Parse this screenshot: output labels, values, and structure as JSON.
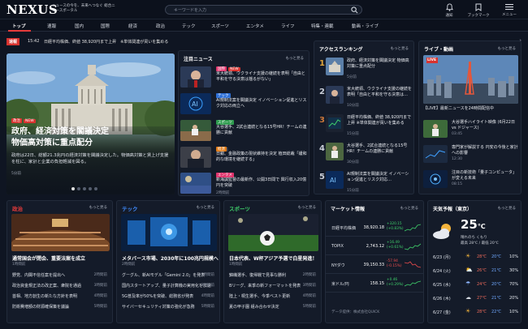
{
  "header": {
    "logo": "NEXUS",
    "tagline": "ニュースの今を、未来へつなぐ 総合ニュースポータル",
    "search_placeholder": "キーワードを入力",
    "icons": [
      {
        "name": "bell-icon",
        "label": "通知"
      },
      {
        "name": "bookmark-icon",
        "label": "ブックマーク"
      },
      {
        "name": "menu-icon",
        "label": "メニュー"
      }
    ]
  },
  "nav": [
    "トップ",
    "速報",
    "国内",
    "国際",
    "経済",
    "政治",
    "テック",
    "スポーツ",
    "エンタメ",
    "ライフ",
    "特集・連載",
    "動画・ライブ"
  ],
  "ticker": {
    "label": "速報",
    "time": "15:42",
    "text": "日経平均株価、終値 38,920円まで上昇　※単体関連が買いを集める"
  },
  "hero": {
    "badges": [
      "政治",
      "NEW"
    ],
    "title_line1": "政府、経済対策を閣議決定",
    "title_line2": "物価高対策に重点配分",
    "summary": "政府は22日、総額21.3兆円の経済対策を閣議決定した。物価高対策と賃上げ支援を柱に、家計と企業の負担軽減を図る。",
    "time": "5分前"
  },
  "attention": {
    "title": "注目ニュース",
    "more": "もっと見る",
    "items": [
      {
        "badges": [
          "国際",
          "NEW"
        ],
        "title": "米大統領、ウクライナ支援の継続を表明「自由と平和を守る決意は揺るがない」",
        "time": "10分前"
      },
      {
        "badges": [
          "テック"
        ],
        "title": "AI規制法案を閣議決定 イノベーション促進とリスク対応の両立へ",
        "time": "15分前"
      },
      {
        "badges": [
          "スポーツ"
        ],
        "title": "大谷選手、2試合連続となる15号HR！チームの連勝に貢献",
        "time": "30分前"
      },
      {
        "badges": [
          "経済"
        ],
        "title": "日銀、金融政策の現状維持を決定 植田総裁「緩和的な環境を継続する」",
        "time": "1時間前"
      },
      {
        "badges": [
          "エンタメ"
        ],
        "title": "新海誠監督の最新作、公開3日間で 興行収入20億円を突破",
        "time": "2時間前"
      }
    ]
  },
  "ranking": {
    "title": "アクセスランキング",
    "more": "もっと見る",
    "items": [
      {
        "rank": "1",
        "title": "政府、経済対策を閣議決定 物価高対策に重点配分",
        "time": "5分前"
      },
      {
        "rank": "2",
        "title": "米大統領、ウクライナ支援の継続を表明「自由と平和を守る決意は…",
        "time": "10分前"
      },
      {
        "rank": "3",
        "title": "日経平均株価、終値 38,920円まで上昇 ※単体関連が買いを集める",
        "time": "15分前"
      },
      {
        "rank": "4",
        "title": "大谷選手、2試合連続となる15号HR！チームの連勝に貢献",
        "time": "30分前"
      },
      {
        "rank": "5",
        "title": "AI規制法案を閣議決定 イノベーション促進とリスク対応…",
        "time": "15分前"
      }
    ]
  },
  "live": {
    "title": "ライブ・動画",
    "more": "もっと見る",
    "badge": "LIVE",
    "main_title": "【LIVE】最新ニュースを24時間配信中",
    "items": [
      {
        "title": "大谷選手ハイライト映像 (6月22日 vs ドジャース)",
        "duration": "03:45"
      },
      {
        "title": "専門家が解説する 円安の今後と家計への影響",
        "duration": "12:30"
      },
      {
        "title": "注目の新技術「量子コンピュータ」が変える未来",
        "duration": "08:15"
      }
    ]
  },
  "politics": {
    "title": "政治",
    "more": "もっと見る",
    "lead": "通常国会が閉会、重要法案を成立",
    "lead_time": "1時間前",
    "items": [
      {
        "title": "野党、内閣不信任案を提出へ",
        "time": "2時間前"
      },
      {
        "title": "政治資金規正法の改正案、衆院を通過",
        "time": "3時間前"
      },
      {
        "title": "首相、地方創生の新たな方針を表明",
        "time": "4時間前"
      },
      {
        "title": "防衛費増額の財源確保策を議論",
        "time": "5時間前"
      }
    ]
  },
  "tech": {
    "title": "テック",
    "more": "もっと見る",
    "lead": "メタバース市場、2030年に100兆円規模へ",
    "lead_time": "2時間前",
    "items": [
      {
        "title": "グーグル、新AIモデル「Gemini 2.0」を発表",
        "time": "1時間前"
      },
      {
        "title": "国内スタートアップ、量子計算機の実用化を加速",
        "time": "3時間前"
      },
      {
        "title": "5G普及率が50%を突破、総務省が発表",
        "time": "4時間前"
      },
      {
        "title": "サイバーセキュリティ対策の強化が急務",
        "time": "5時間前"
      }
    ]
  },
  "sports": {
    "title": "スポーツ",
    "more": "もっと見る",
    "lead": "日本代表、W杯アジア予選で白星発進！",
    "lead_time": "1時間前",
    "items": [
      {
        "title": "錦織選手、復帰戦で見事な勝利",
        "time": "2時間前"
      },
      {
        "title": "Bリーグ、来季の新フォーマットを発表",
        "time": "3時間前"
      },
      {
        "title": "陸上・桐生選手、今季ベスト更新",
        "time": "4時間前"
      },
      {
        "title": "夏の甲子園 組み合わせ決定",
        "time": "5時間前"
      }
    ]
  },
  "market": {
    "title": "マーケット情報",
    "more": "もっと見る",
    "rows": [
      {
        "name": "日経平均株価",
        "value": "38,920.18",
        "change": "+320.15",
        "pct": "(+0.83%)",
        "dir": "up"
      },
      {
        "name": "TOPIX",
        "value": "2,743.12",
        "change": "+16.49",
        "pct": "(+0.61%)",
        "dir": "up"
      },
      {
        "name": "NYダウ",
        "value": "39,150.33",
        "change": "-57.94",
        "pct": "(-0.15%)",
        "dir": "down"
      },
      {
        "name": "米ドル/円",
        "value": "158.15",
        "change": "+0.46",
        "pct": "(+0.29%)",
        "dir": "up"
      }
    ],
    "source": "データ提供：株式会社QUICK"
  },
  "weather": {
    "title": "天気予報（東京）",
    "more": "もっと見る",
    "temp": "25",
    "unit": "℃",
    "desc": "晴れのち くもり",
    "range": "最高 28℃ / 最低 20℃",
    "days": [
      {
        "day": "6/23 (月)",
        "hi": "28℃",
        "lo": "20℃",
        "pct": "10%"
      },
      {
        "day": "6/24 (火)",
        "hi": "26℃",
        "lo": "21℃",
        "pct": "30%"
      },
      {
        "day": "6/25 (水)",
        "hi": "24℃",
        "lo": "20℃",
        "pct": "70%"
      },
      {
        "day": "6/26 (木)",
        "hi": "27℃",
        "lo": "21℃",
        "pct": "20%"
      },
      {
        "day": "6/27 (金)",
        "hi": "28℃",
        "lo": "22℃",
        "pct": "10%"
      }
    ]
  },
  "colors": {
    "accent": "#e63b3b",
    "up": "#3fcf6b",
    "down": "#ef4d4d"
  }
}
